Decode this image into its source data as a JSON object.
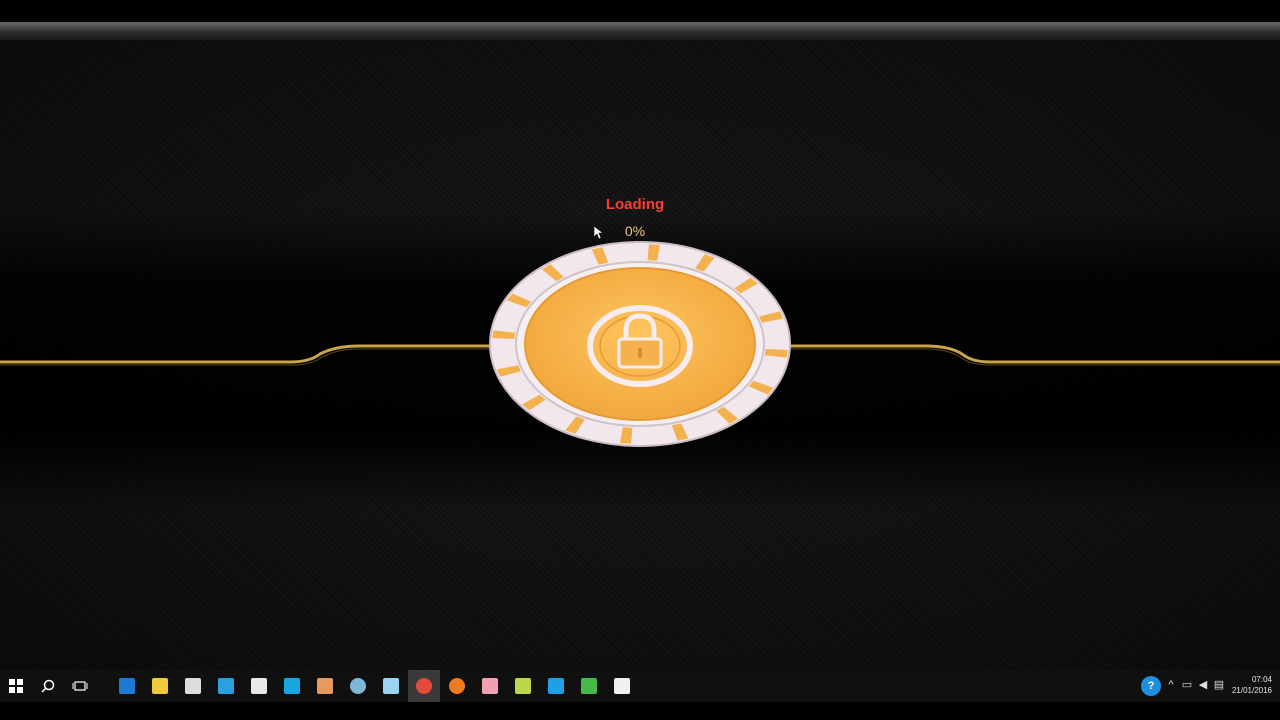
{
  "loader": {
    "status_label": "Loading",
    "progress_text": "0%",
    "progress": 0.0
  },
  "colors": {
    "status_red": "#ff3b2f",
    "progress_gold": "#f2c77a",
    "wheel_orange": "#f4b24e",
    "wheel_white": "#f3e7ee"
  },
  "taskbar": {
    "clock_time": "07:04",
    "clock_date": "21/01/2016",
    "pinned": [
      {
        "name": "edge-icon",
        "color": "#1e78d6"
      },
      {
        "name": "file-explorer-icon",
        "color": "#f0c93a"
      },
      {
        "name": "store-icon",
        "color": "#dddddd"
      },
      {
        "name": "network-app-icon",
        "color": "#2aa0e0"
      },
      {
        "name": "hp-icon",
        "color": "#e8e8e8"
      },
      {
        "name": "skype-app-icon",
        "color": "#18a6e0"
      },
      {
        "name": "paint-icon",
        "color": "#e89a5c"
      },
      {
        "name": "globe-app-icon",
        "color": "#7fb7d8"
      },
      {
        "name": "notes-icon",
        "color": "#9ad4f0"
      },
      {
        "name": "chrome-icon",
        "color": "#e34a3a"
      },
      {
        "name": "firefox-icon",
        "color": "#f07a1e"
      },
      {
        "name": "brain-app-icon",
        "color": "#f0a0b0"
      },
      {
        "name": "folder-green-icon",
        "color": "#b8d84a"
      },
      {
        "name": "skype-icon",
        "color": "#1ea0e8"
      },
      {
        "name": "camtasia-icon",
        "color": "#48b848"
      },
      {
        "name": "document-icon",
        "color": "#f0f0f0"
      }
    ]
  }
}
